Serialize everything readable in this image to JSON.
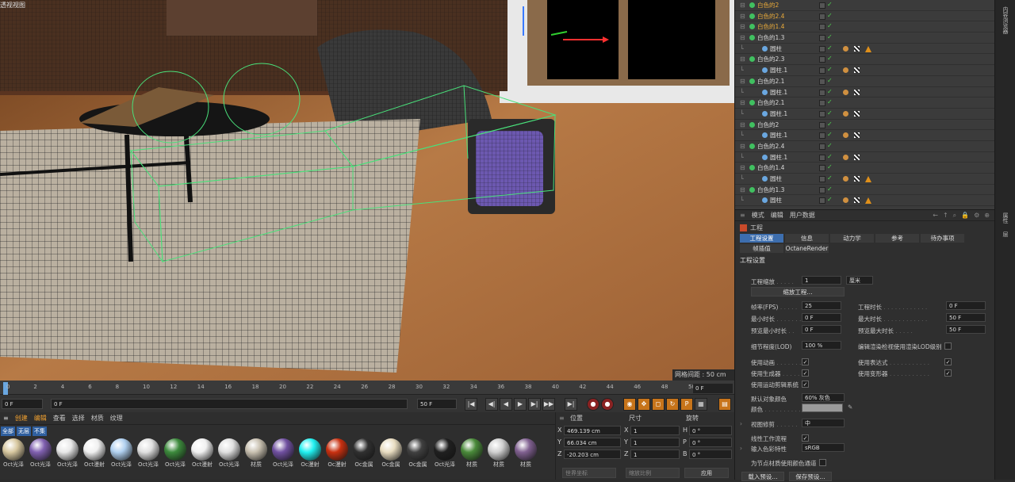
{
  "viewport": {
    "title": "透视视图",
    "grid_label": "网格间距 : 50 cm"
  },
  "timeline": {
    "ticks": [
      "0",
      "2",
      "4",
      "6",
      "8",
      "10",
      "12",
      "14",
      "16",
      "18",
      "20",
      "22",
      "24",
      "26",
      "28",
      "30",
      "32",
      "34",
      "36",
      "38",
      "40",
      "42",
      "44",
      "46",
      "48",
      "50"
    ],
    "end_frame": "0 F",
    "current": "0 F",
    "start": "0 F",
    "max1": "50 F",
    "max2": "50 F"
  },
  "materials": {
    "menu": [
      "创建",
      "编辑",
      "查看",
      "选择",
      "材质",
      "纹理"
    ],
    "filters": [
      "全部",
      "无层",
      "不集"
    ],
    "items": [
      {
        "label": "Oct光泽",
        "color": "#d8c8a0"
      },
      {
        "label": "Oct光泽",
        "color": "#8060b0"
      },
      {
        "label": "Oct光泽",
        "color": "#e8e8e8"
      },
      {
        "label": "Oct漫射",
        "color": "#f0f0f0"
      },
      {
        "label": "Oct光泽",
        "color": "#b0d0f0"
      },
      {
        "label": "Oct光泽",
        "color": "#e0e0e0"
      },
      {
        "label": "Oct光泽",
        "color": "#3c8a3c"
      },
      {
        "label": "Oct漫射",
        "color": "#f0f0f0"
      },
      {
        "label": "Oct光泽",
        "color": "#e0e0e0"
      },
      {
        "label": "材质",
        "color": "#c8c0b0"
      },
      {
        "label": "Oct光泽",
        "color": "#7050a0"
      },
      {
        "label": "Oc漫射",
        "color": "#20f0f0"
      },
      {
        "label": "Oc漫射",
        "color": "#c83010"
      },
      {
        "label": "Oc金属",
        "color": "#303030"
      },
      {
        "label": "Oc金属",
        "color": "#e8dcc0"
      },
      {
        "label": "Oc金属",
        "color": "#404040"
      },
      {
        "label": "Oct光泽",
        "color": "#202020"
      },
      {
        "label": "材质",
        "color": "#4a8a3a"
      },
      {
        "label": "材质",
        "color": "#d0d0d0"
      },
      {
        "label": "材质",
        "color": "#806090"
      }
    ]
  },
  "coords": {
    "headers": [
      "位置",
      "尺寸",
      "旋转"
    ],
    "rows": [
      {
        "axis": "X",
        "pos": "469.139 cm",
        "size_axis": "X",
        "size": "1",
        "rot_axis": "H",
        "rot": "0 °"
      },
      {
        "axis": "Y",
        "pos": "66.034 cm",
        "size_axis": "Y",
        "size": "1",
        "rot_axis": "P",
        "rot": "0 °"
      },
      {
        "axis": "Z",
        "pos": "-20.203 cm",
        "size_axis": "Z",
        "size": "1",
        "rot_axis": "B",
        "rot": "0 °"
      }
    ],
    "coord_mode": "世界坐标",
    "scale_mode": "缩放比例",
    "apply": "应用"
  },
  "objects": [
    {
      "name": "白色的2",
      "indent": 0,
      "color": "orange",
      "tags": 0
    },
    {
      "name": "白色的2.4",
      "indent": 0,
      "color": "orange",
      "tags": 0
    },
    {
      "name": "白色的1.4",
      "indent": 0,
      "color": "orange",
      "tags": 0
    },
    {
      "name": "白色的1.3",
      "indent": 0,
      "color": "white",
      "tags": 0
    },
    {
      "name": "圆柱",
      "indent": 1,
      "color": "white",
      "tags": 3
    },
    {
      "name": "白色的2.3",
      "indent": 0,
      "color": "white",
      "tags": 0
    },
    {
      "name": "圆柱.1",
      "indent": 1,
      "color": "white",
      "tags": 2
    },
    {
      "name": "白色的2.1",
      "indent": 0,
      "color": "white",
      "tags": 0
    },
    {
      "name": "圆柱.1",
      "indent": 1,
      "color": "white",
      "tags": 2
    },
    {
      "name": "白色的2.1",
      "indent": 0,
      "color": "white",
      "tags": 0
    },
    {
      "name": "圆柱.1",
      "indent": 1,
      "color": "white",
      "tags": 2
    },
    {
      "name": "白色的2",
      "indent": 0,
      "color": "white",
      "tags": 0
    },
    {
      "name": "圆柱.1",
      "indent": 1,
      "color": "white",
      "tags": 2
    },
    {
      "name": "白色的2.4",
      "indent": 0,
      "color": "white",
      "tags": 0
    },
    {
      "name": "圆柱.1",
      "indent": 1,
      "color": "white",
      "tags": 2
    },
    {
      "name": "白色的1.4",
      "indent": 0,
      "color": "white",
      "tags": 0
    },
    {
      "name": "圆柱",
      "indent": 1,
      "color": "white",
      "tags": 3
    },
    {
      "name": "白色的1.3",
      "indent": 0,
      "color": "white",
      "tags": 0
    },
    {
      "name": "圆柱",
      "indent": 1,
      "color": "white",
      "tags": 3
    }
  ],
  "attributes": {
    "menu": [
      "模式",
      "编辑",
      "用户数据"
    ],
    "object_name": "工程",
    "tabs": [
      "工程设置",
      "信息",
      "动力学",
      "参考",
      "待办事项",
      "帧插值",
      "OctaneRender"
    ],
    "section": "工程设置",
    "scale_label": "工程缩放",
    "scale_value": "1",
    "scale_unit": "厘米",
    "scale_button": "缩放工程...",
    "fps_label": "帧率(FPS)",
    "fps_value": "25",
    "proj_time_label": "工程时长",
    "proj_time_value": "0 F",
    "min_time_label": "最小时长",
    "min_time_value": "0 F",
    "max_time_label": "最大时长",
    "max_time_value": "50 F",
    "prev_min_label": "预览最小时长",
    "prev_min_value": "0 F",
    "prev_max_label": "预览最大时长",
    "prev_max_value": "50 F",
    "lod_label": "细节程度(LOD)",
    "lod_value": "100 %",
    "render_lod_label": "编辑渲染检视使用渲染LOD级别",
    "use_anim_label": "使用动画",
    "use_expr_label": "使用表达式",
    "use_gen_label": "使用生成器",
    "use_deform_label": "使用变形器",
    "use_motion_label": "使用运动剪辑系统",
    "default_color_label": "默认对象颜色",
    "default_color_value": "60% 灰色",
    "color_label": "颜色",
    "view_clip_label": "视图修剪",
    "view_clip_value": "中",
    "linear_label": "线性工作流程",
    "input_color_label": "输入色彩特性",
    "input_color_value": "sRGB",
    "node_label": "为节点材质使用颜色通道",
    "load_preset": "载入预设...",
    "save_preset": "保存预设..."
  },
  "sidebar": {
    "top": "内容浏览器",
    "bottom1": "属性",
    "bottom2": "层"
  }
}
